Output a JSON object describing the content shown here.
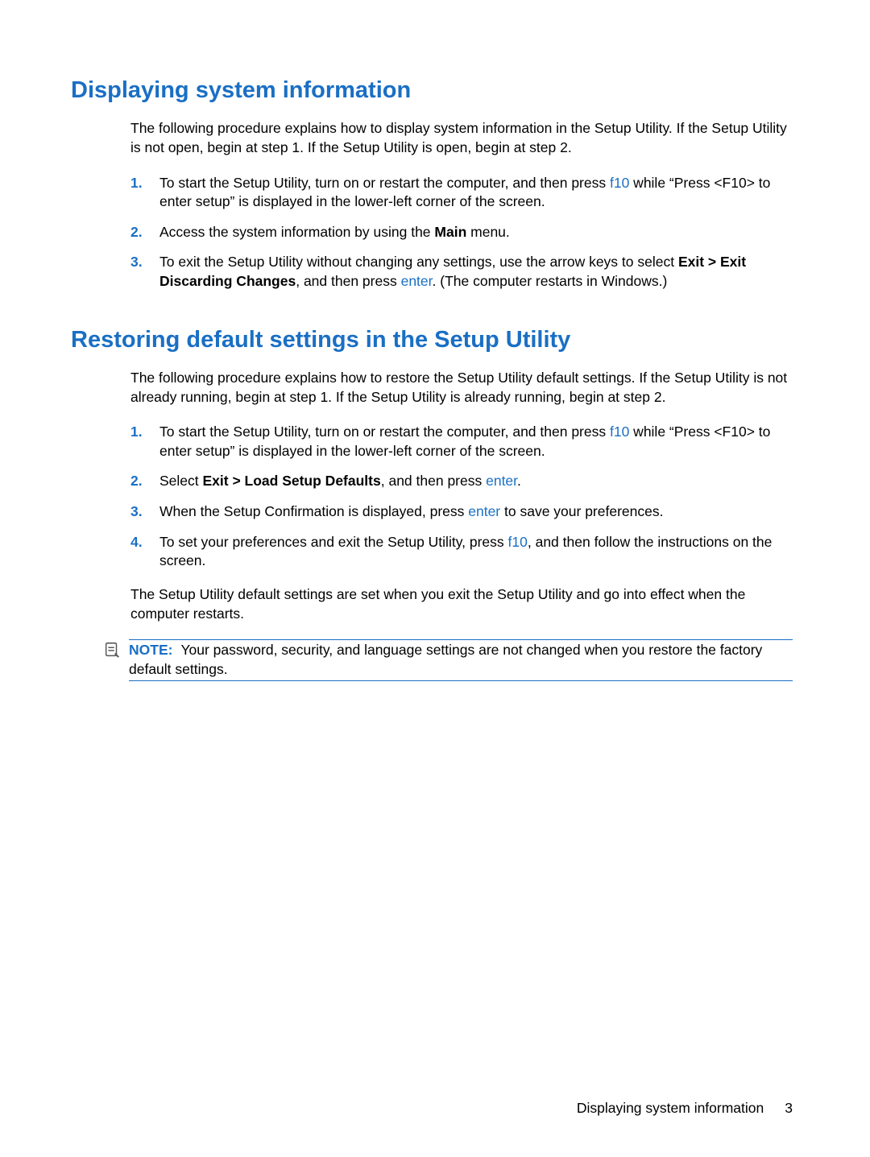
{
  "section1": {
    "heading": "Displaying system information",
    "intro": "The following procedure explains how to display system information in the Setup Utility. If the Setup Utility is not open, begin at step 1. If the Setup Utility is open, begin at step 2.",
    "steps": {
      "s1": {
        "num": "1.",
        "t1": "To start the Setup Utility, turn on or restart the computer, and then press ",
        "key": "f10",
        "t2": " while “Press <F10> to enter setup” is displayed in the lower-left corner of the screen."
      },
      "s2": {
        "num": "2.",
        "t1": "Access the system information by using the ",
        "bold": "Main",
        "t2": " menu."
      },
      "s3": {
        "num": "3.",
        "t1": "To exit the Setup Utility without changing any settings, use the arrow keys to select ",
        "bold": "Exit > Exit Discarding Changes",
        "t2": ", and then press ",
        "key": "enter",
        "t3": ". (The computer restarts in Windows.)"
      }
    }
  },
  "section2": {
    "heading": "Restoring default settings in the Setup Utility",
    "intro": "The following procedure explains how to restore the Setup Utility default settings. If the Setup Utility is not already running, begin at step 1. If the Setup Utility is already running, begin at step 2.",
    "steps": {
      "s1": {
        "num": "1.",
        "t1": "To start the Setup Utility, turn on or restart the computer, and then press ",
        "key": "f10",
        "t2": " while “Press <F10> to enter setup” is displayed in the lower-left corner of the screen."
      },
      "s2": {
        "num": "2.",
        "t1": "Select ",
        "bold": "Exit > Load Setup Defaults",
        "t2": ", and then press ",
        "key": "enter",
        "t3": "."
      },
      "s3": {
        "num": "3.",
        "t1": "When the Setup Confirmation is displayed, press ",
        "key": "enter",
        "t2": " to save your preferences."
      },
      "s4": {
        "num": "4.",
        "t1": "To set your preferences and exit the Setup Utility, press ",
        "key": "f10",
        "t2": ", and then follow the instructions on the screen."
      }
    },
    "para_after": "The Setup Utility default settings are set when you exit the Setup Utility and go into effect when the computer restarts.",
    "note": {
      "label": "NOTE:",
      "text": "Your password, security, and language settings are not changed when you restore the factory default settings."
    }
  },
  "footer": {
    "chapter": "Displaying system information",
    "page": "3"
  }
}
